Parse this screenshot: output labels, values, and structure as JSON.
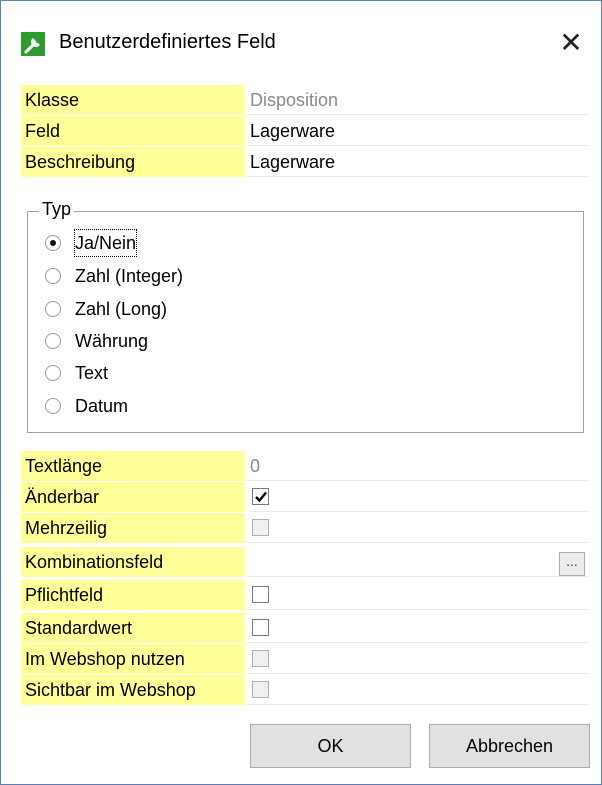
{
  "window": {
    "title": "Benutzerdefiniertes Feld",
    "icon": "wrench-icon",
    "close_label": "✕"
  },
  "fields_top": [
    {
      "label": "Klasse",
      "value": "Disposition",
      "readonly": true
    },
    {
      "label": "Feld",
      "value": "Lagerware"
    },
    {
      "label": "Beschreibung",
      "value": "Lagerware"
    }
  ],
  "typ_group": {
    "legend": "Typ",
    "selected": "Ja/Nein",
    "options": [
      "Ja/Nein",
      "Zahl (Integer)",
      "Zahl (Long)",
      "Währung",
      "Text",
      "Datum"
    ]
  },
  "fields_bottom": {
    "textlaenge": {
      "label": "Textlänge",
      "value": "0"
    },
    "aenderbar": {
      "label": "Änderbar",
      "checked": true,
      "enabled": true
    },
    "mehrzeilig": {
      "label": "Mehrzeilig",
      "checked": false,
      "enabled": false
    },
    "kombinationsfeld": {
      "label": "Kombinationsfeld",
      "value": "",
      "button_label": "..."
    },
    "pflichtfeld": {
      "label": "Pflichtfeld",
      "checked": false,
      "enabled": true
    },
    "standardwert": {
      "label": "Standardwert",
      "checked": false,
      "enabled": true
    },
    "webshop_nutzen": {
      "label": "Im Webshop nutzen",
      "checked": false,
      "enabled": false
    },
    "sichtbar_webshop": {
      "label": "Sichtbar im Webshop",
      "checked": false,
      "enabled": false
    }
  },
  "buttons": {
    "ok": "OK",
    "cancel": "Abbrechen"
  },
  "colors": {
    "label_background": "#ffff99",
    "window_border": "#5a7fb5",
    "icon_green": "#2e9b2e"
  }
}
